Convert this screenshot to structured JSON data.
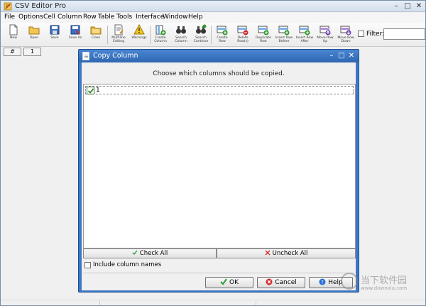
{
  "window": {
    "title": "CSV Editor Pro"
  },
  "menu": [
    {
      "label": "File"
    },
    {
      "label": "Options"
    },
    {
      "label": "Cell"
    },
    {
      "label": "Column"
    },
    {
      "label": "Row"
    },
    {
      "label": "Table"
    },
    {
      "label": "Tools"
    },
    {
      "label": "Interface"
    },
    {
      "label": "Window"
    },
    {
      "label": "Help"
    }
  ],
  "toolbar": [
    {
      "label": "New",
      "icon": "new-file-icon"
    },
    {
      "label": "Open",
      "icon": "open-folder-icon"
    },
    {
      "label": "Save",
      "icon": "save-icon"
    },
    {
      "label": "Save As",
      "icon": "save-as-icon"
    },
    {
      "label": "Close",
      "icon": "close-folder-icon"
    },
    {
      "label": "Multiline\nEditing",
      "icon": "multiline-edit-icon"
    },
    {
      "label": "Warnings",
      "icon": "warning-icon"
    },
    {
      "label": "Create\nColumn",
      "icon": "create-column-icon"
    },
    {
      "label": "Search\nColumn",
      "icon": "binoculars-icon"
    },
    {
      "label": "Search\nContinue",
      "icon": "binoculars-continue-icon"
    },
    {
      "label": "Create\nRow",
      "icon": "create-row-icon"
    },
    {
      "label": "Delete\nRow(s)",
      "icon": "delete-row-icon"
    },
    {
      "label": "Duplicate\nRow",
      "icon": "duplicate-row-icon"
    },
    {
      "label": "Insert Row\nBefore",
      "icon": "insert-row-before-icon"
    },
    {
      "label": "Insert Row\nAfter",
      "icon": "insert-row-after-icon"
    },
    {
      "label": "Move Row\nUp",
      "icon": "move-row-up-icon"
    },
    {
      "label": "Move Row\nDown",
      "icon": "move-row-down-icon"
    }
  ],
  "filter": {
    "label": "Filter:",
    "value": ""
  },
  "tabs": [
    "#",
    "1"
  ],
  "dialog": {
    "title": "Copy Column",
    "prompt": "Choose which columns should be copied.",
    "columns": [
      {
        "name": "1",
        "checked": true
      }
    ],
    "check_all": "Check All",
    "uncheck_all": "Uncheck All",
    "include_names": "Include column names",
    "ok": "OK",
    "cancel": "Cancel",
    "help": "Help"
  },
  "watermark": {
    "text": "当下软件园",
    "url": "www.downxia.com"
  },
  "colors": {
    "dialog_frame": "#3f78c4",
    "ok_icon": "#2e9b2e",
    "cancel_icon": "#d22a2a",
    "help_icon": "#2b6fd6"
  }
}
